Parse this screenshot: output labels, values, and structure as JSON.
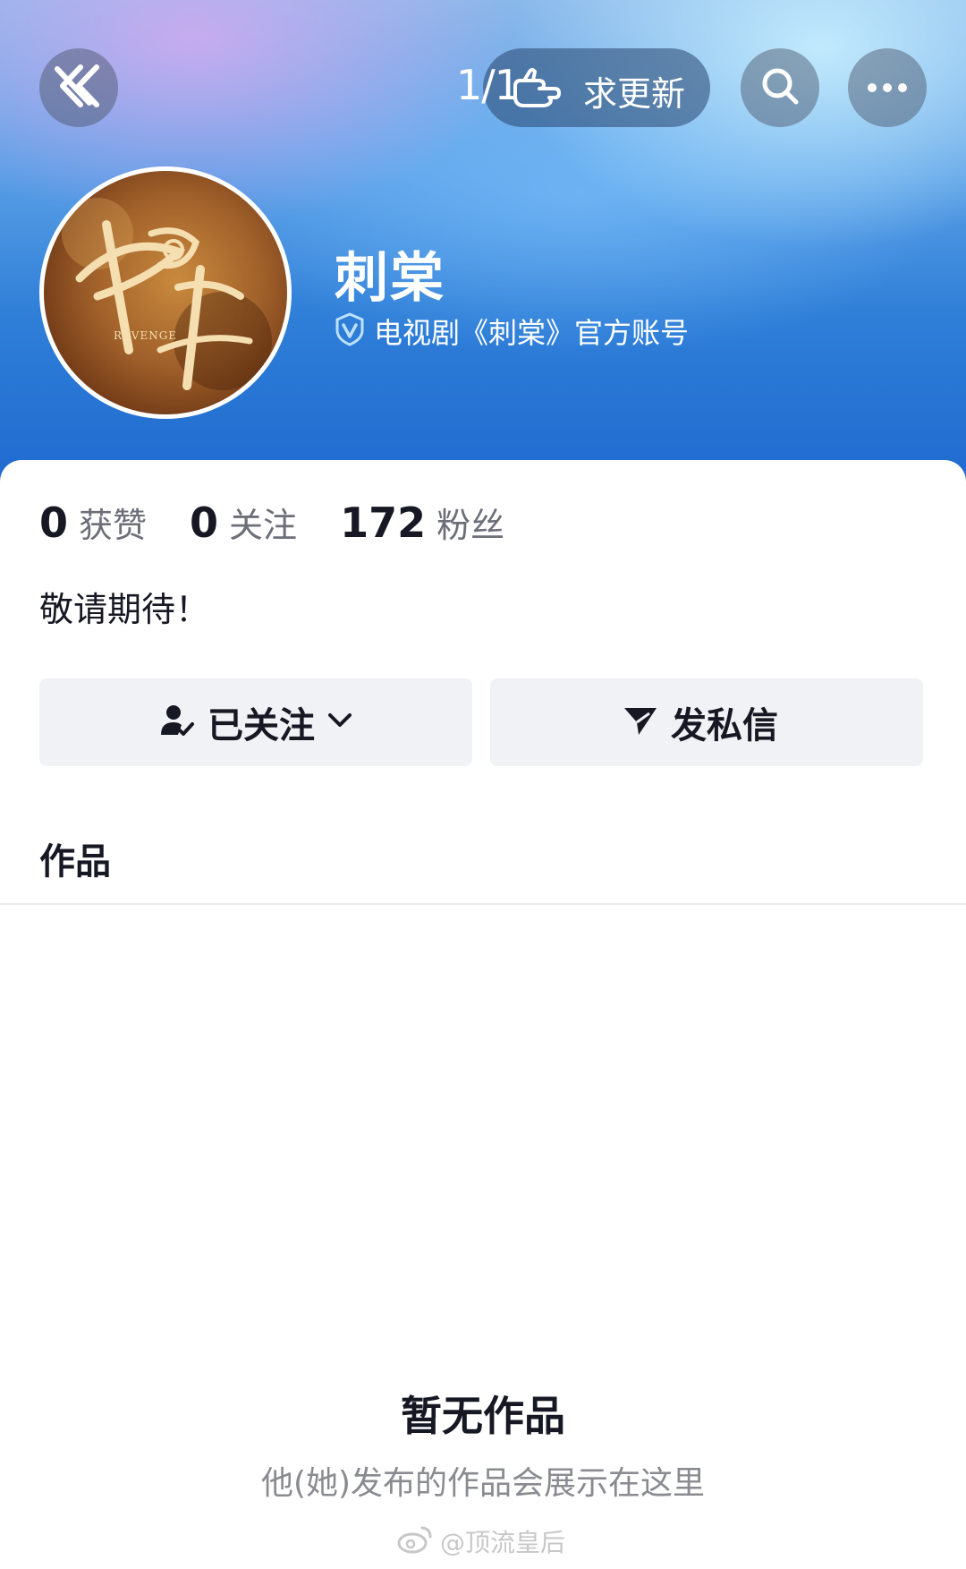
{
  "header": {
    "page_counter": "1/1",
    "update_request_label": "求更新",
    "back_icon": "double-chevron-left-icon",
    "search_icon": "search-icon",
    "more_icon": "more-dots-icon",
    "colors": {
      "header_gradient_top": "#8ab8ea",
      "header_gradient_bottom": "#1f6ad0"
    }
  },
  "profile": {
    "name": "刺棠",
    "verification_text": "电视剧《刺棠》官方账号",
    "avatar_logo": {
      "calligraphy": "刺棠",
      "subtitle": "REVENGE"
    }
  },
  "stats": [
    {
      "value": "0",
      "label": "获赞"
    },
    {
      "value": "0",
      "label": "关注"
    },
    {
      "value": "172",
      "label": "粉丝"
    }
  ],
  "bio": "敬请期待！",
  "actions": {
    "follow_label": "已关注",
    "message_label": "发私信"
  },
  "tabs": {
    "works_label": "作品"
  },
  "empty_state": {
    "title": "暂无作品",
    "subtitle": "他(她)发布的作品会展示在这里"
  },
  "watermark": {
    "text": "@顶流皇后"
  }
}
